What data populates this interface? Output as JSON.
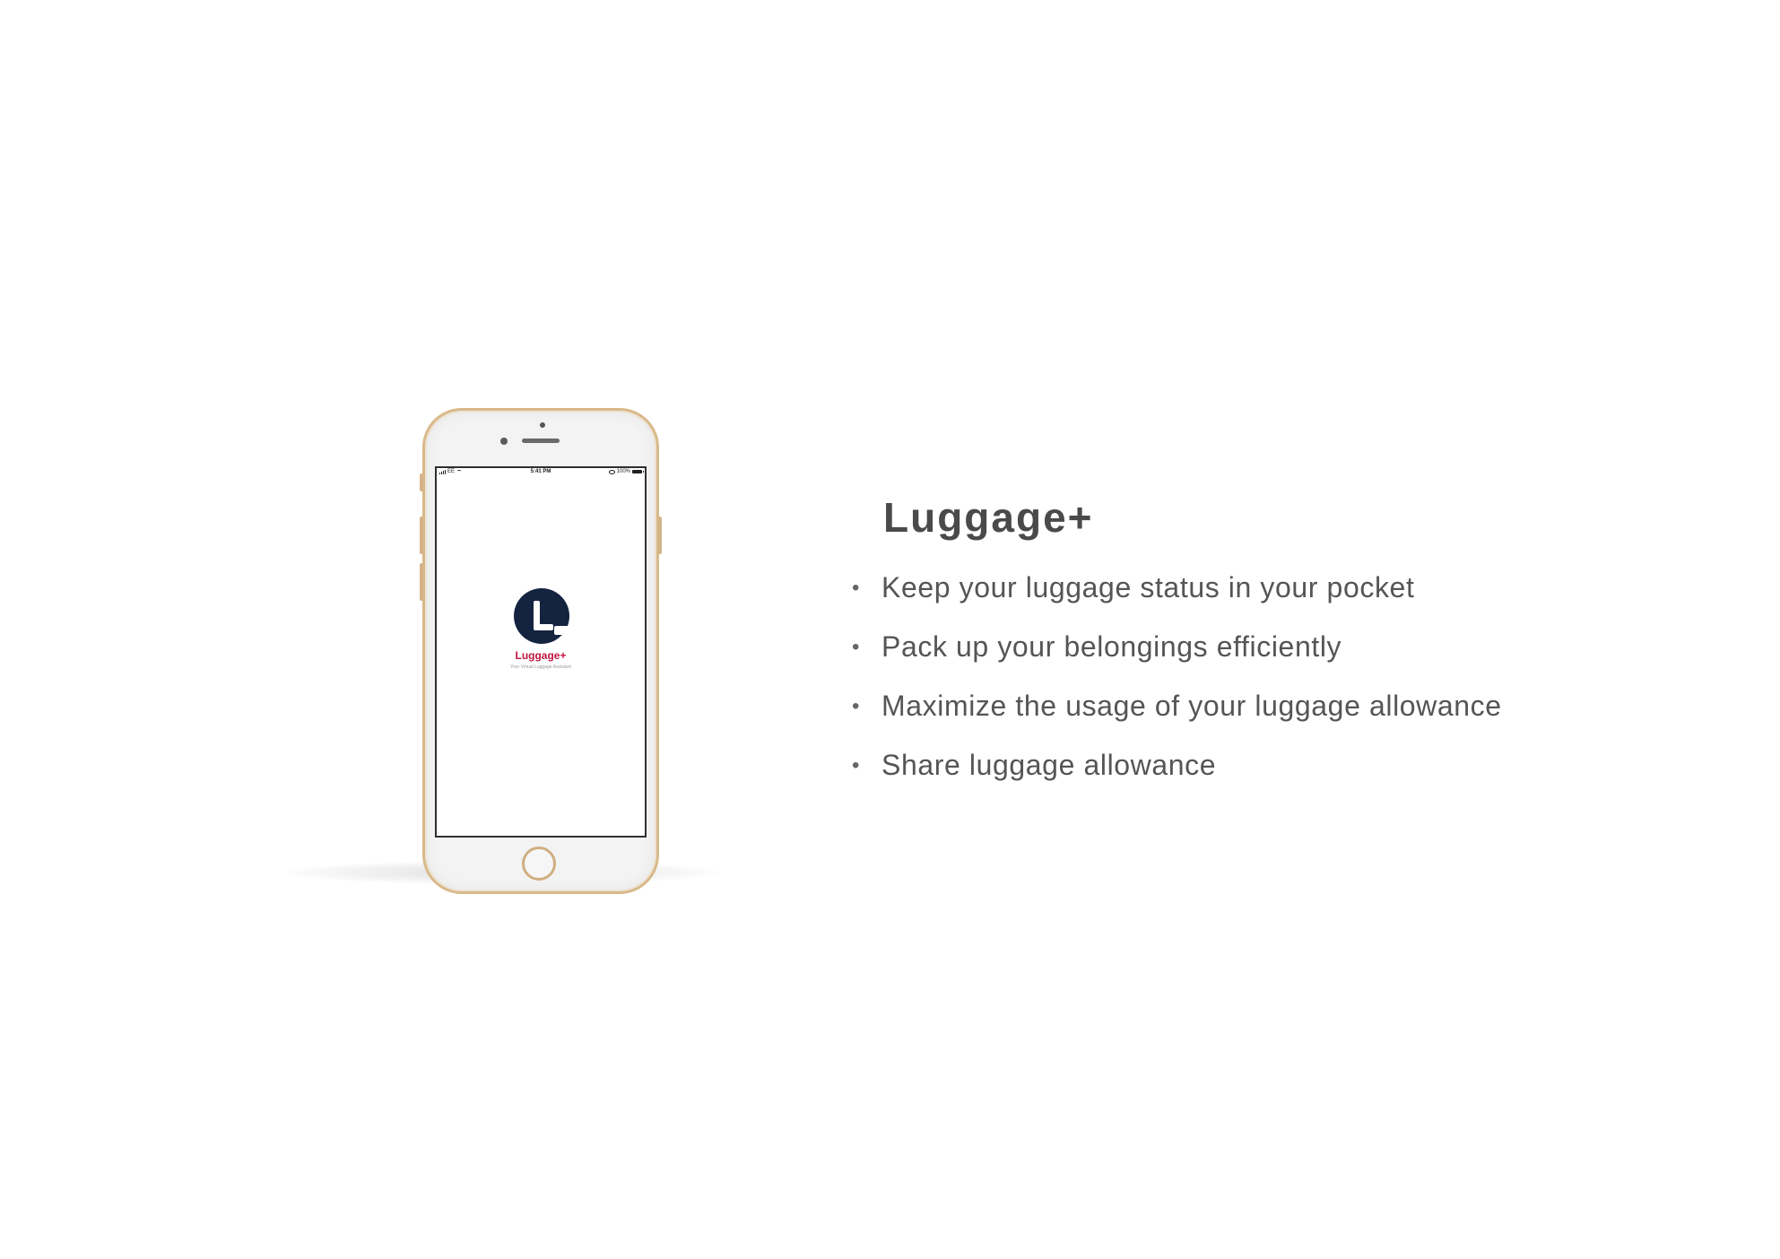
{
  "phone": {
    "status_bar": {
      "carrier": "EE",
      "time": "5:41 PM",
      "battery": "100%"
    },
    "splash": {
      "app_name": "Luggage+",
      "tagline": "Your Virtual Luggage Assistant",
      "logo_color": "#14233f",
      "brand_color": "#c0173f"
    }
  },
  "content": {
    "title": "Luggage+",
    "features": [
      "Keep your luggage status in your pocket",
      "Pack up your belongings efficiently",
      "Maximize the usage of your luggage allowance",
      "Share luggage allowance"
    ]
  }
}
